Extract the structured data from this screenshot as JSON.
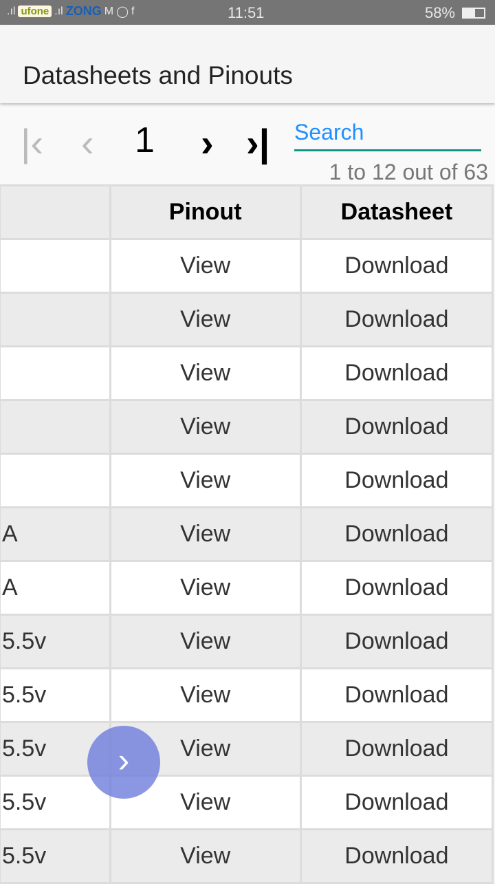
{
  "status_bar": {
    "carrier1": "ufone",
    "carrier2": "ZONG",
    "time": "11:51",
    "battery": "58%",
    "battery_level": 0.58
  },
  "app_bar": {
    "title": "Datasheets and Pinouts"
  },
  "pager": {
    "page": "1",
    "search_placeholder": "Search",
    "count": "1 to 12 out of 63",
    "first_icon": "first-page",
    "prev_icon": "chevron-left",
    "next_icon": "chevron-right",
    "last_icon": "last-page"
  },
  "table": {
    "headers": [
      "",
      "Pinout",
      "Datasheet"
    ],
    "rows": [
      [
        "",
        "View",
        "Download"
      ],
      [
        "",
        "View",
        "Download"
      ],
      [
        "",
        "View",
        "Download"
      ],
      [
        "",
        "View",
        "Download"
      ],
      [
        "",
        "View",
        "Download"
      ],
      [
        "A",
        "View",
        "Download"
      ],
      [
        "A",
        "View",
        "Download"
      ],
      [
        "5.5v",
        "View",
        "Download"
      ],
      [
        "5.5v",
        "View",
        "Download"
      ],
      [
        "5.5v",
        "View",
        "Download"
      ],
      [
        "5.5v",
        "View",
        "Download"
      ],
      [
        "5.5v",
        "View",
        "Download"
      ]
    ]
  },
  "fab": {
    "icon": "chevron-right"
  }
}
